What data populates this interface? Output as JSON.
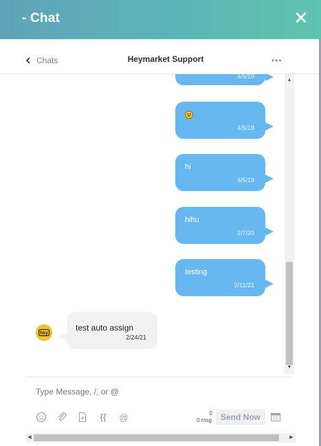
{
  "window": {
    "title": "- Chat",
    "close_glyph": "✕"
  },
  "header": {
    "back_label": "Chats",
    "contact_name": "Heymarket Support",
    "more_glyph": "•••"
  },
  "messages": [
    {
      "direction": "outgoing",
      "text": "",
      "time": "4/5/19",
      "partial": true
    },
    {
      "direction": "outgoing",
      "text": "",
      "emoji": "grinning-emoji",
      "time": "4/5/19"
    },
    {
      "direction": "outgoing",
      "text": "hi",
      "time": "4/5/19"
    },
    {
      "direction": "outgoing",
      "text": "hihu",
      "time": "2/7/20"
    },
    {
      "direction": "outgoing",
      "text": "testing",
      "time": "2/11/21"
    },
    {
      "direction": "incoming",
      "text": "test auto assign",
      "time": "2/24/21",
      "avatar": "hey"
    }
  ],
  "composer": {
    "placeholder": "Type Message, /, or @",
    "counter_count": "0",
    "counter_unit": "msg",
    "send_label": "Send Now",
    "tools": [
      "smiley-icon",
      "paperclip-icon",
      "file-template-icon",
      "curly-braces-icon",
      "at-sign-icon"
    ]
  },
  "colors": {
    "outgoing_bubble": "#67b8f1",
    "incoming_bubble": "#f1f1f1",
    "header_gradient_start": "#5ea3b8",
    "header_gradient_end": "#5fc3ad",
    "avatar": "#f2c230"
  }
}
